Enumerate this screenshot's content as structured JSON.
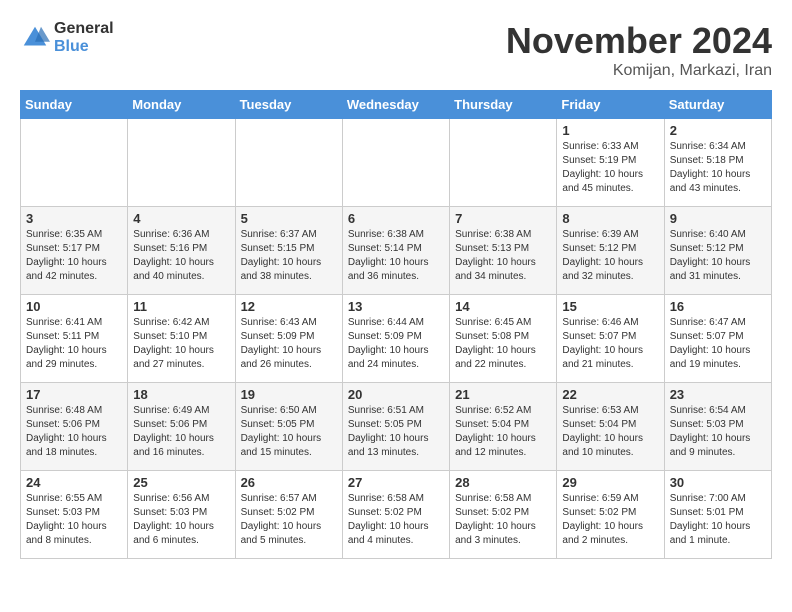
{
  "logo": {
    "general": "General",
    "blue": "Blue"
  },
  "title": "November 2024",
  "subtitle": "Komijan, Markazi, Iran",
  "days_of_week": [
    "Sunday",
    "Monday",
    "Tuesday",
    "Wednesday",
    "Thursday",
    "Friday",
    "Saturday"
  ],
  "weeks": [
    [
      {
        "day": "",
        "info": ""
      },
      {
        "day": "",
        "info": ""
      },
      {
        "day": "",
        "info": ""
      },
      {
        "day": "",
        "info": ""
      },
      {
        "day": "",
        "info": ""
      },
      {
        "day": "1",
        "info": "Sunrise: 6:33 AM\nSunset: 5:19 PM\nDaylight: 10 hours and 45 minutes."
      },
      {
        "day": "2",
        "info": "Sunrise: 6:34 AM\nSunset: 5:18 PM\nDaylight: 10 hours and 43 minutes."
      }
    ],
    [
      {
        "day": "3",
        "info": "Sunrise: 6:35 AM\nSunset: 5:17 PM\nDaylight: 10 hours and 42 minutes."
      },
      {
        "day": "4",
        "info": "Sunrise: 6:36 AM\nSunset: 5:16 PM\nDaylight: 10 hours and 40 minutes."
      },
      {
        "day": "5",
        "info": "Sunrise: 6:37 AM\nSunset: 5:15 PM\nDaylight: 10 hours and 38 minutes."
      },
      {
        "day": "6",
        "info": "Sunrise: 6:38 AM\nSunset: 5:14 PM\nDaylight: 10 hours and 36 minutes."
      },
      {
        "day": "7",
        "info": "Sunrise: 6:38 AM\nSunset: 5:13 PM\nDaylight: 10 hours and 34 minutes."
      },
      {
        "day": "8",
        "info": "Sunrise: 6:39 AM\nSunset: 5:12 PM\nDaylight: 10 hours and 32 minutes."
      },
      {
        "day": "9",
        "info": "Sunrise: 6:40 AM\nSunset: 5:12 PM\nDaylight: 10 hours and 31 minutes."
      }
    ],
    [
      {
        "day": "10",
        "info": "Sunrise: 6:41 AM\nSunset: 5:11 PM\nDaylight: 10 hours and 29 minutes."
      },
      {
        "day": "11",
        "info": "Sunrise: 6:42 AM\nSunset: 5:10 PM\nDaylight: 10 hours and 27 minutes."
      },
      {
        "day": "12",
        "info": "Sunrise: 6:43 AM\nSunset: 5:09 PM\nDaylight: 10 hours and 26 minutes."
      },
      {
        "day": "13",
        "info": "Sunrise: 6:44 AM\nSunset: 5:09 PM\nDaylight: 10 hours and 24 minutes."
      },
      {
        "day": "14",
        "info": "Sunrise: 6:45 AM\nSunset: 5:08 PM\nDaylight: 10 hours and 22 minutes."
      },
      {
        "day": "15",
        "info": "Sunrise: 6:46 AM\nSunset: 5:07 PM\nDaylight: 10 hours and 21 minutes."
      },
      {
        "day": "16",
        "info": "Sunrise: 6:47 AM\nSunset: 5:07 PM\nDaylight: 10 hours and 19 minutes."
      }
    ],
    [
      {
        "day": "17",
        "info": "Sunrise: 6:48 AM\nSunset: 5:06 PM\nDaylight: 10 hours and 18 minutes."
      },
      {
        "day": "18",
        "info": "Sunrise: 6:49 AM\nSunset: 5:06 PM\nDaylight: 10 hours and 16 minutes."
      },
      {
        "day": "19",
        "info": "Sunrise: 6:50 AM\nSunset: 5:05 PM\nDaylight: 10 hours and 15 minutes."
      },
      {
        "day": "20",
        "info": "Sunrise: 6:51 AM\nSunset: 5:05 PM\nDaylight: 10 hours and 13 minutes."
      },
      {
        "day": "21",
        "info": "Sunrise: 6:52 AM\nSunset: 5:04 PM\nDaylight: 10 hours and 12 minutes."
      },
      {
        "day": "22",
        "info": "Sunrise: 6:53 AM\nSunset: 5:04 PM\nDaylight: 10 hours and 10 minutes."
      },
      {
        "day": "23",
        "info": "Sunrise: 6:54 AM\nSunset: 5:03 PM\nDaylight: 10 hours and 9 minutes."
      }
    ],
    [
      {
        "day": "24",
        "info": "Sunrise: 6:55 AM\nSunset: 5:03 PM\nDaylight: 10 hours and 8 minutes."
      },
      {
        "day": "25",
        "info": "Sunrise: 6:56 AM\nSunset: 5:03 PM\nDaylight: 10 hours and 6 minutes."
      },
      {
        "day": "26",
        "info": "Sunrise: 6:57 AM\nSunset: 5:02 PM\nDaylight: 10 hours and 5 minutes."
      },
      {
        "day": "27",
        "info": "Sunrise: 6:58 AM\nSunset: 5:02 PM\nDaylight: 10 hours and 4 minutes."
      },
      {
        "day": "28",
        "info": "Sunrise: 6:58 AM\nSunset: 5:02 PM\nDaylight: 10 hours and 3 minutes."
      },
      {
        "day": "29",
        "info": "Sunrise: 6:59 AM\nSunset: 5:02 PM\nDaylight: 10 hours and 2 minutes."
      },
      {
        "day": "30",
        "info": "Sunrise: 7:00 AM\nSunset: 5:01 PM\nDaylight: 10 hours and 1 minute."
      }
    ]
  ]
}
